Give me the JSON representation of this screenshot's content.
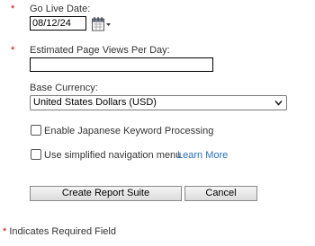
{
  "go_live": {
    "required_mark": "*",
    "label": "Go Live Date:",
    "value": "08/12/24",
    "calendar_icon": "calendar-icon"
  },
  "page_views": {
    "required_mark": "*",
    "label": "Estimated Page Views Per Day:",
    "value": ""
  },
  "currency": {
    "label": "Base Currency:",
    "selected": "United States Dollars (USD)",
    "arrow_icon": "chevron-down-icon"
  },
  "options": {
    "japanese_label": "Enable Japanese Keyword Processing",
    "japanese_checked": false,
    "simplified_nav_label": "Use simplified navigation menu",
    "simplified_nav_checked": false,
    "learn_more": "Learn More"
  },
  "actions": {
    "create_label": "Create Report Suite",
    "cancel_label": "Cancel"
  },
  "footer": {
    "required_mark": "*",
    "note": " Indicates Required Field"
  },
  "colors": {
    "required": "#d40000",
    "link": "#2a6fb8",
    "text": "#333333"
  }
}
